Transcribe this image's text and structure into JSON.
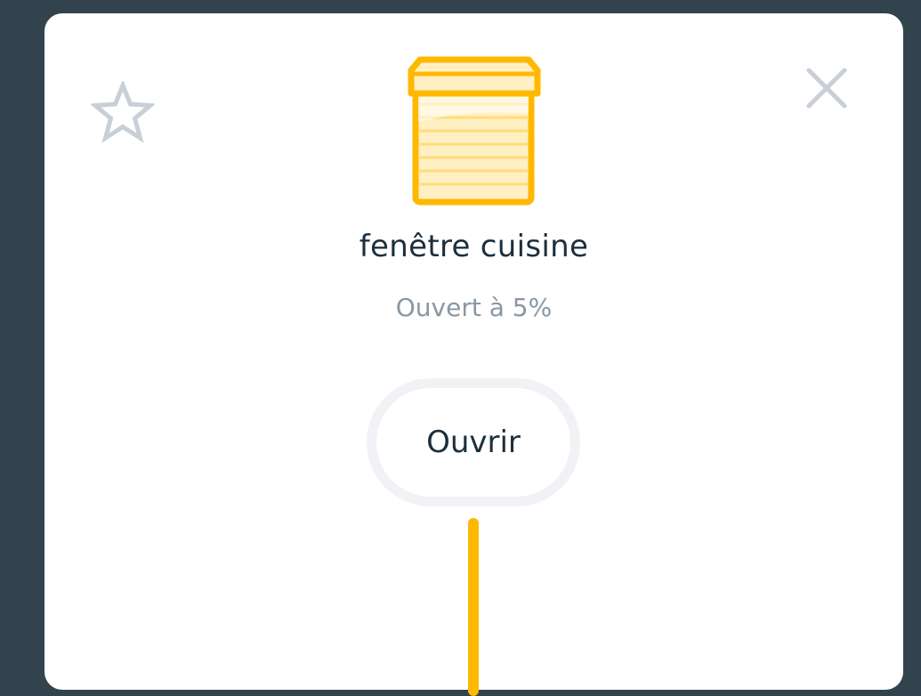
{
  "device": {
    "name": "fenêtre cuisine",
    "status": "Ouvert à 5%",
    "open_percent": 5
  },
  "actions": {
    "open_label": "Ouvrir"
  },
  "icons": {
    "favorite": "star-outline-icon",
    "close": "close-icon",
    "device": "blind-icon"
  },
  "colors": {
    "background": "#32434e",
    "accent": "#ffb800",
    "accent_light": "#fff0c4",
    "icon_gray": "#c9cfd6",
    "title_text": "#1c2f3d",
    "subtitle_text": "#8a97a3"
  }
}
